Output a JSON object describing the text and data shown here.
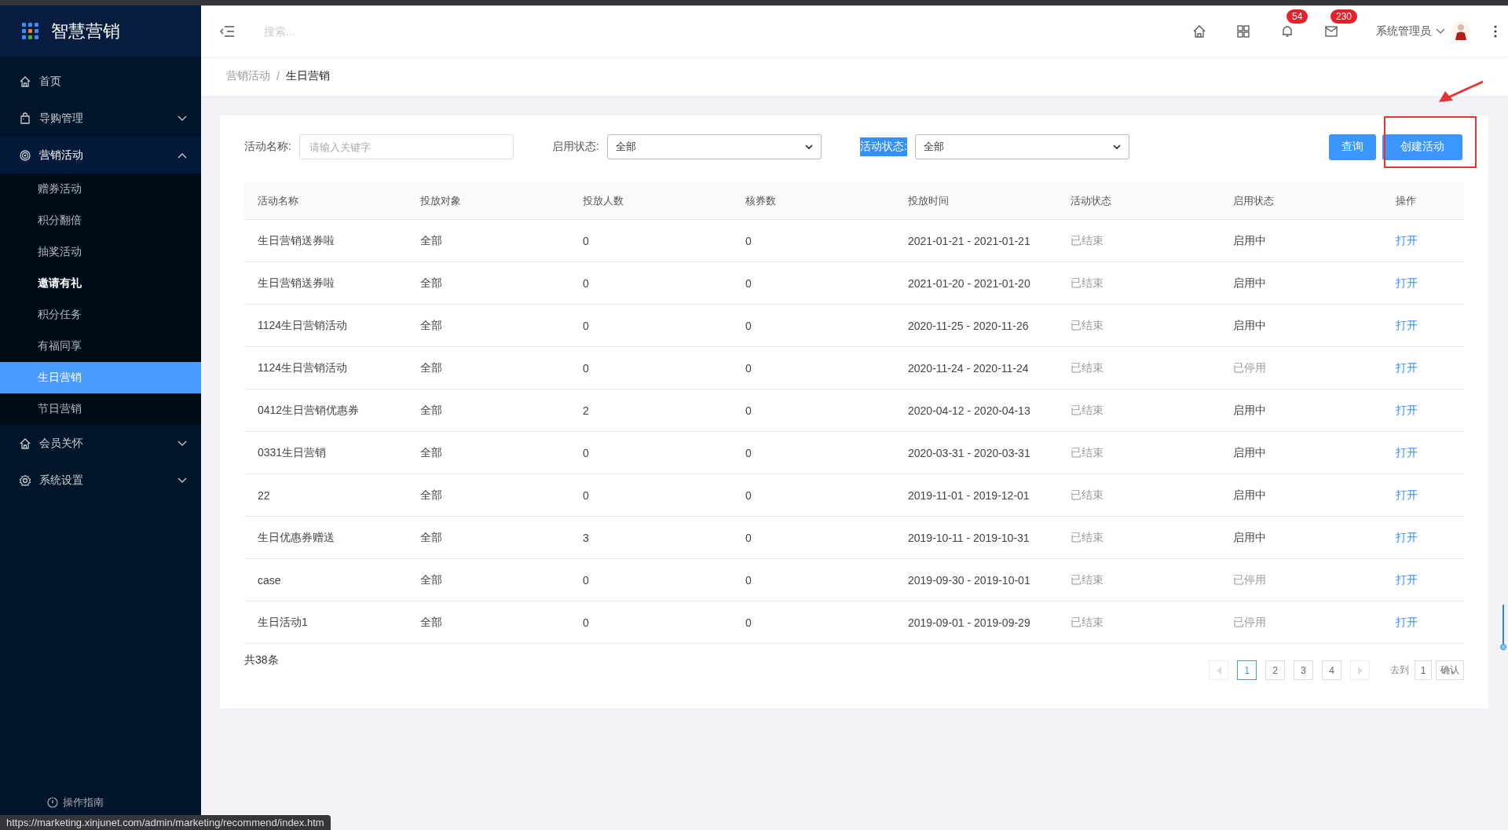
{
  "app": {
    "title": "智慧营销"
  },
  "sidebar": {
    "items": [
      {
        "kind": "link",
        "label": "首页",
        "selected": false
      },
      {
        "kind": "group",
        "label": "导购管理",
        "expanded": false
      },
      {
        "kind": "group",
        "label": "营销活动",
        "expanded": true,
        "children": [
          {
            "label": "赠券活动",
            "selected": false,
            "hovered": false
          },
          {
            "label": "积分翻倍",
            "selected": false,
            "hovered": false
          },
          {
            "label": "抽奖活动",
            "selected": false,
            "hovered": false
          },
          {
            "label": "邀请有礼",
            "selected": false,
            "hovered": true
          },
          {
            "label": "积分任务",
            "selected": false,
            "hovered": false
          },
          {
            "label": "有福同享",
            "selected": false,
            "hovered": false
          },
          {
            "label": "生日营销",
            "selected": true,
            "hovered": false
          },
          {
            "label": "节日营销",
            "selected": false,
            "hovered": false
          }
        ]
      },
      {
        "kind": "group",
        "label": "会员关怀",
        "expanded": false
      },
      {
        "kind": "group",
        "label": "系统设置",
        "expanded": false
      }
    ],
    "footer": "操作指南"
  },
  "header": {
    "search": {
      "placeholder": "搜索..."
    },
    "icons": [
      {
        "kind": "home"
      },
      {
        "kind": "grid"
      },
      {
        "kind": "bell",
        "badge": "54"
      },
      {
        "kind": "mail",
        "badge": "230"
      }
    ],
    "user": "系统管理员"
  },
  "breadcrumb": {
    "items": [
      {
        "label": "营销活动",
        "current": false
      },
      {
        "label": "生日营销",
        "current": true
      }
    ],
    "separator": "/"
  },
  "filters": [
    {
      "kind": "text",
      "label": "活动名称:",
      "placeholder": "请输入关键字",
      "highlighted": false
    },
    {
      "kind": "select",
      "label": "启用状态:",
      "value": "全部",
      "highlighted": false
    },
    {
      "kind": "select",
      "label": "活动状态:",
      "value": "全部",
      "highlighted": true
    }
  ],
  "buttons": [
    {
      "label": "查询"
    },
    {
      "label": "创建活动"
    }
  ],
  "table": {
    "columns": [
      "活动名称",
      "投放对象",
      "投放人数",
      "核券数",
      "投放时间",
      "活动状态",
      "启用状态",
      "操作"
    ],
    "rows": [
      {
        "cells": [
          "生日营销送券啦",
          "全部",
          "0",
          "0",
          "2021-01-21 - 2021-01-21",
          "已结束",
          "启用中",
          "打开"
        ],
        "enabled": true
      },
      {
        "cells": [
          "生日营销送券啦",
          "全部",
          "0",
          "0",
          "2021-01-20 - 2021-01-20",
          "已结束",
          "启用中",
          "打开"
        ],
        "enabled": true
      },
      {
        "cells": [
          "1124生日营销活动",
          "全部",
          "0",
          "0",
          "2020-11-25 - 2020-11-26",
          "已结束",
          "启用中",
          "打开"
        ],
        "enabled": true
      },
      {
        "cells": [
          "1124生日营销活动",
          "全部",
          "0",
          "0",
          "2020-11-24 - 2020-11-24",
          "已结束",
          "已停用",
          "打开"
        ],
        "enabled": false
      },
      {
        "cells": [
          "0412生日营销优惠券",
          "全部",
          "2",
          "0",
          "2020-04-12 - 2020-04-13",
          "已结束",
          "启用中",
          "打开"
        ],
        "enabled": true
      },
      {
        "cells": [
          "0331生日营销",
          "全部",
          "0",
          "0",
          "2020-03-31 - 2020-03-31",
          "已结束",
          "启用中",
          "打开"
        ],
        "enabled": true
      },
      {
        "cells": [
          "22",
          "全部",
          "0",
          "0",
          "2019-11-01 - 2019-12-01",
          "已结束",
          "启用中",
          "打开"
        ],
        "enabled": true
      },
      {
        "cells": [
          "生日优惠券赠送",
          "全部",
          "3",
          "0",
          "2019-10-11 - 2019-10-31",
          "已结束",
          "启用中",
          "打开"
        ],
        "enabled": true
      },
      {
        "cells": [
          "case",
          "全部",
          "0",
          "0",
          "2019-09-30 - 2019-10-01",
          "已结束",
          "已停用",
          "打开"
        ],
        "enabled": false
      },
      {
        "cells": [
          "生日活动1",
          "全部",
          "0",
          "0",
          "2019-09-01 - 2019-09-29",
          "已结束",
          "已停用",
          "打开"
        ],
        "enabled": false
      }
    ]
  },
  "pagination": {
    "total": "共38条",
    "prev_disabled": true,
    "next_disabled": true,
    "pages": [
      {
        "label": "1",
        "selected": true
      },
      {
        "label": "2",
        "selected": false
      },
      {
        "label": "3",
        "selected": false
      },
      {
        "label": "4",
        "selected": false
      }
    ],
    "goto_label": "去到",
    "goto_value": "1",
    "confirm": "确认"
  },
  "status_bar": "https://marketing.xinjunet.com/admin/marketing/recommend/index.htm"
}
